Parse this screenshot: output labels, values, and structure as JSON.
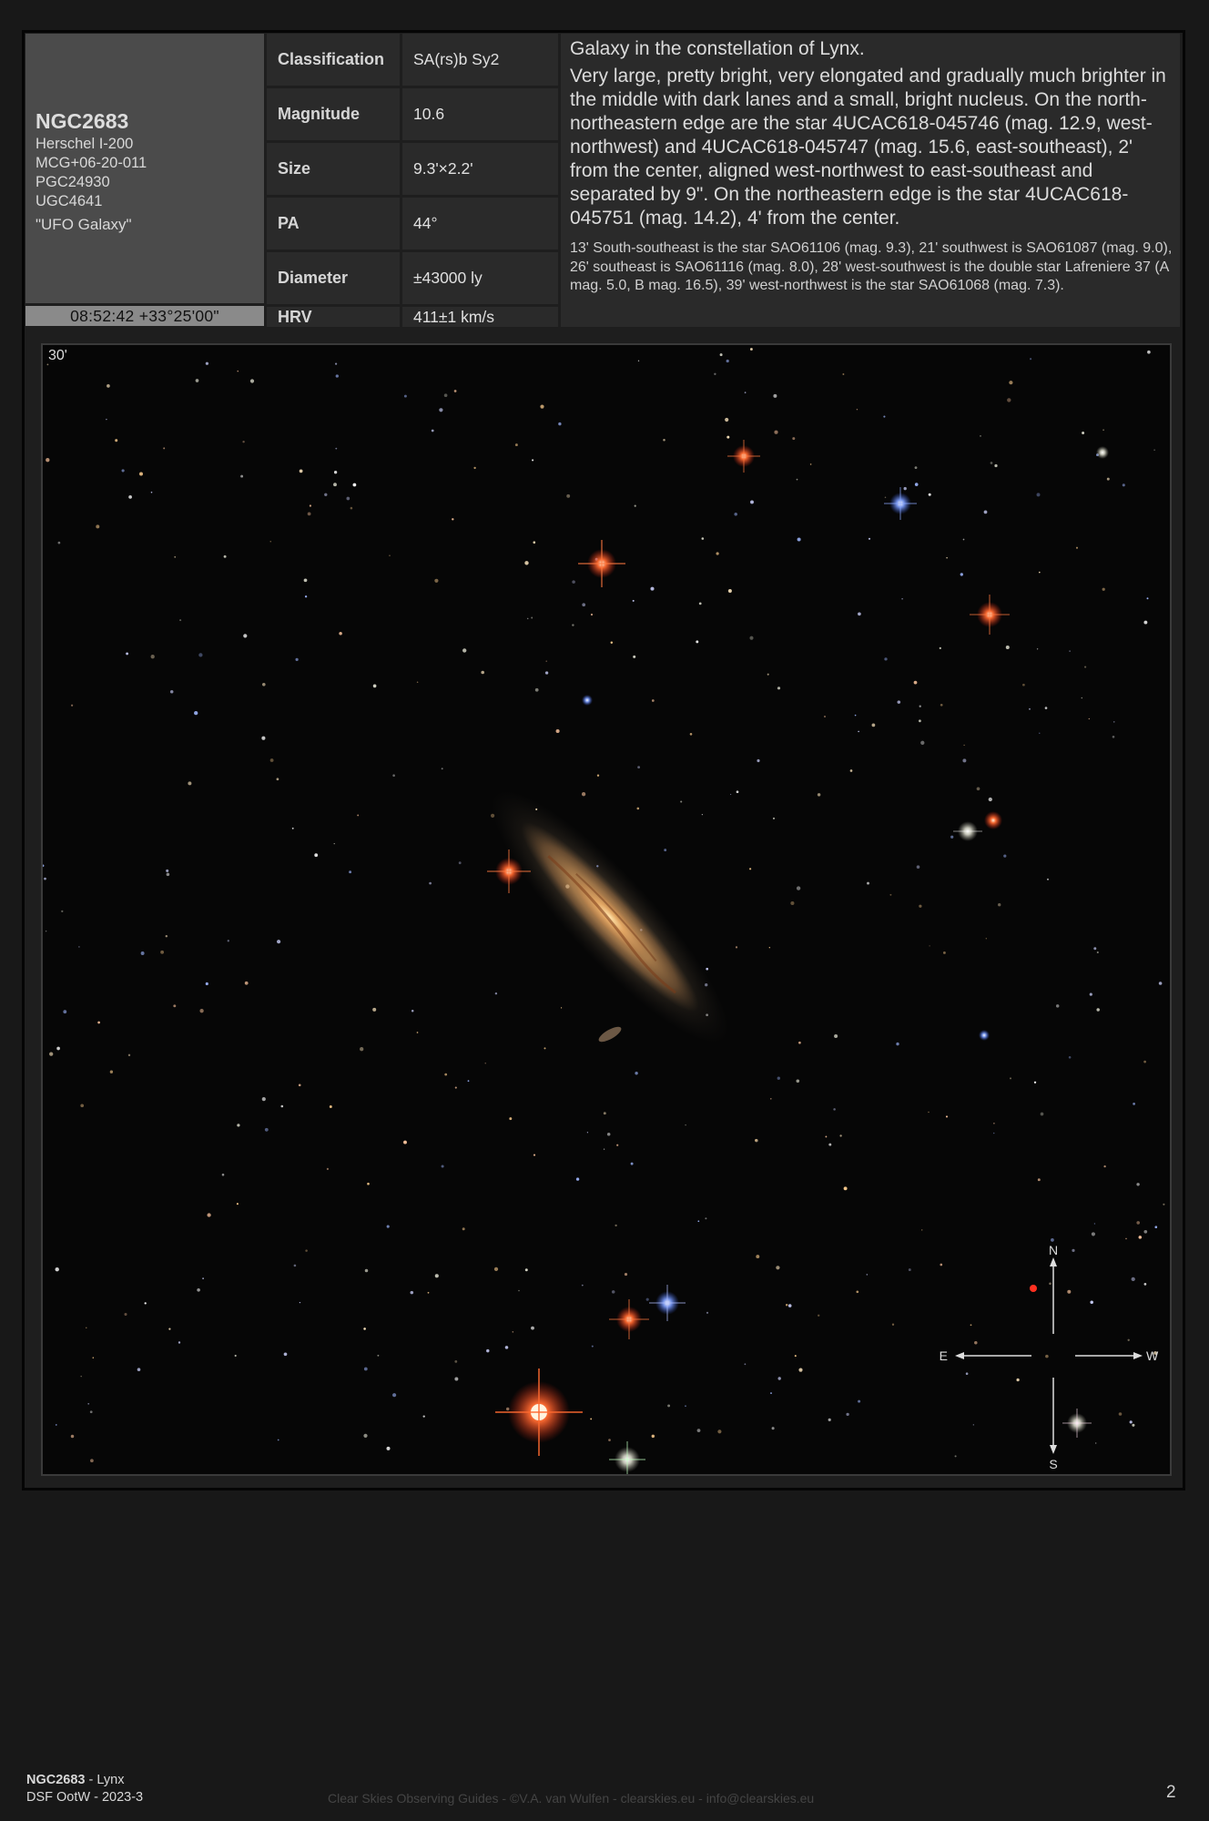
{
  "object": {
    "name": "NGC2683",
    "aliases": [
      "Herschel I-200",
      "MCG+06-20-011",
      "PGC24930",
      "UGC4641"
    ],
    "nickname": "\"UFO Galaxy\"",
    "coordinates": "08:52:42 +33°25'00\""
  },
  "properties": [
    {
      "label": "Classification",
      "value": "SA(rs)b Sy2"
    },
    {
      "label": "Magnitude",
      "value": "10.6"
    },
    {
      "label": "Size",
      "value": "9.3'×2.2'"
    },
    {
      "label": "PA",
      "value": "44°"
    },
    {
      "label": "Diameter",
      "value": "±43000 ly"
    },
    {
      "label": "HRV",
      "value": "411±1 km/s"
    }
  ],
  "description": {
    "intro": "Galaxy in the constellation of Lynx.",
    "main": "Very large, pretty bright, very elongated and gradually much brighter in the middle with dark lanes and a small, bright nucleus. On the north-northeastern edge are the star 4UCAC618-045746 (mag. 12.9, west-northwest) and 4UCAC618-045747 (mag. 15.6, east-southeast), 2' from the center, aligned west-northwest to east-southeast and separated by 9\". On the northeastern edge is the star 4UCAC618-045751 (mag. 14.2), 4' from the center.",
    "note": "13' South-southeast is the star SAO61106 (mag. 9.3), 21' southwest is SAO61087 (mag. 9.0), 26' southeast is SAO61116 (mag. 8.0), 28' west-southwest is the double star Lafreniere 37 (A mag. 5.0, B mag. 16.5), 39' west-northwest is the star SAO61068 (mag. 7.3)."
  },
  "image": {
    "scale_label": "30'",
    "compass": {
      "n": "N",
      "s": "S",
      "e": "E",
      "w": "W"
    }
  },
  "footer": {
    "object": "NGC2683",
    "constellation": " - Lynx",
    "series": "DSF OotW - 2023-3",
    "credits": "Clear Skies Observing Guides - ©V.A. van Wulfen - clearskies.eu - info@clearskies.eu",
    "page": "2"
  }
}
